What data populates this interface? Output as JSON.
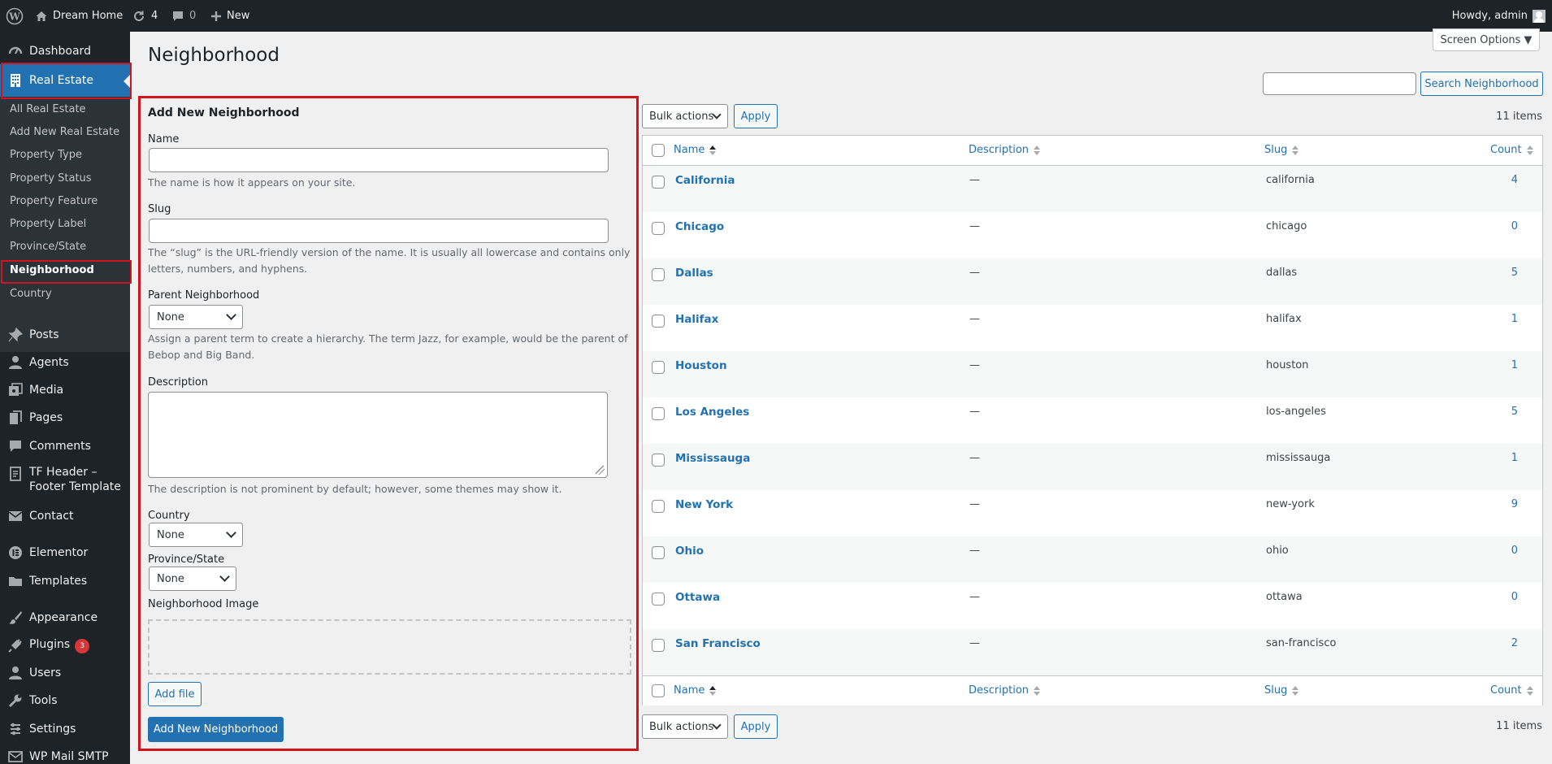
{
  "adminbar": {
    "site_name": "Dream Home",
    "updates_count": "4",
    "comments_count": "0",
    "new_label": "New",
    "greeting": "Howdy, admin"
  },
  "sidebar": {
    "dashboard": "Dashboard",
    "real_estate": "Real Estate",
    "submenu": [
      "All Real Estate",
      "Add New Real Estate",
      "Property Type",
      "Property Status",
      "Property Feature",
      "Property Label",
      "Province/State",
      "Neighborhood",
      "Country"
    ],
    "posts": "Posts",
    "agents": "Agents",
    "media": "Media",
    "pages": "Pages",
    "comments": "Comments",
    "tf_header_1": "TF Header –",
    "tf_header_2": "Footer Template",
    "contact": "Contact",
    "elementor": "Elementor",
    "templates": "Templates",
    "appearance": "Appearance",
    "plugins": "Plugins",
    "plugins_badge": "3",
    "users": "Users",
    "tools": "Tools",
    "settings": "Settings",
    "wp_mail_smtp": "WP Mail SMTP"
  },
  "page": {
    "title": "Neighborhood",
    "screen_options": "Screen Options ▼",
    "search_button": "Search Neighborhood"
  },
  "form": {
    "title": "Add New Neighborhood",
    "name_label": "Name",
    "name_help": "The name is how it appears on your site.",
    "slug_label": "Slug",
    "slug_help_1": "The “slug” is the URL-friendly version of the name. It is usually all lowercase and contains only",
    "slug_help_2": "letters, numbers, and hyphens.",
    "parent_label": "Parent Neighborhood",
    "parent_value": "None",
    "parent_help_1": "Assign a parent term to create a hierarchy. The term Jazz, for example, would be the parent of",
    "parent_help_2": "Bebop and Big Band.",
    "description_label": "Description",
    "description_help": "The description is not prominent by default; however, some themes may show it.",
    "country_label": "Country",
    "country_value": "None",
    "province_label": "Province/State",
    "province_value": "None",
    "image_label": "Neighborhood Image",
    "add_file": "Add file",
    "submit": "Add New Neighborhood"
  },
  "table": {
    "bulk_actions": "Bulk actions",
    "apply": "Apply",
    "items_count": "11 items",
    "columns": {
      "name": "Name",
      "description": "Description",
      "slug": "Slug",
      "count": "Count"
    },
    "rows": [
      {
        "name": "California",
        "description": "—",
        "slug": "california",
        "count": "4"
      },
      {
        "name": "Chicago",
        "description": "—",
        "slug": "chicago",
        "count": "0"
      },
      {
        "name": "Dallas",
        "description": "—",
        "slug": "dallas",
        "count": "5"
      },
      {
        "name": "Halifax",
        "description": "—",
        "slug": "halifax",
        "count": "1"
      },
      {
        "name": "Houston",
        "description": "—",
        "slug": "houston",
        "count": "1"
      },
      {
        "name": "Los Angeles",
        "description": "—",
        "slug": "los-angeles",
        "count": "5"
      },
      {
        "name": "Mississauga",
        "description": "—",
        "slug": "mississauga",
        "count": "1"
      },
      {
        "name": "New York",
        "description": "—",
        "slug": "new-york",
        "count": "9"
      },
      {
        "name": "Ohio",
        "description": "—",
        "slug": "ohio",
        "count": "0"
      },
      {
        "name": "Ottawa",
        "description": "—",
        "slug": "ottawa",
        "count": "0"
      },
      {
        "name": "San Francisco",
        "description": "—",
        "slug": "san-francisco",
        "count": "2"
      }
    ]
  }
}
